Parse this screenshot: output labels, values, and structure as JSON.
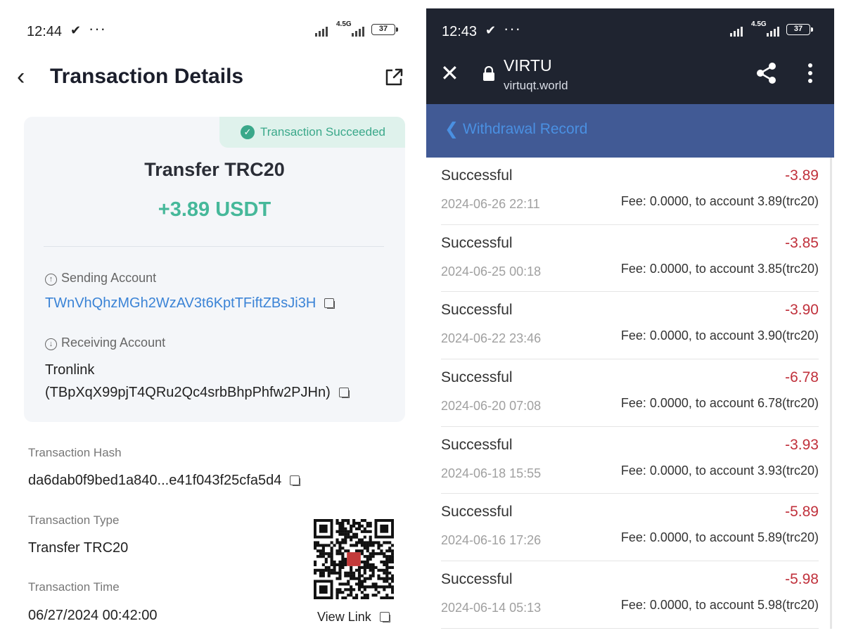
{
  "left": {
    "status": {
      "time": "12:44",
      "nav_indicator": "✔",
      "dots": "···",
      "network": "4.5G",
      "battery": "37"
    },
    "header": {
      "title": "Transaction Details"
    },
    "card": {
      "badge": "Transaction Succeeded",
      "type": "Transfer TRC20",
      "amount": "+3.89 USDT",
      "sending_label": "Sending Account",
      "sending_address": "TWnVhQhzMGh2WzAV3t6KptTFiftZBsJi3H",
      "receiving_label": "Receiving Account",
      "receiving_name": "Tronlink",
      "receiving_address": "(TBpXqX99pjT4QRu2Qc4srbBhpPhfw2PJHn)"
    },
    "fields": {
      "hash_label": "Transaction Hash",
      "hash_value": "da6dab0f9bed1a840...e41f043f25cfa5d4",
      "type_label": "Transaction Type",
      "type_value": "Transfer TRC20",
      "time_label": "Transaction Time",
      "time_value": "06/27/2024 00:42:00"
    },
    "view_link": "View Link",
    "colors": {
      "accent_green": "#46b89a",
      "link_blue": "#3a83d6"
    }
  },
  "right": {
    "status": {
      "time": "12:43",
      "nav_indicator": "✔",
      "dots": "···",
      "network": "4.5G",
      "battery": "37"
    },
    "browser": {
      "site_name": "VIRTU",
      "site_url": "virtuqt.world"
    },
    "page_title": "Withdrawal Record",
    "records": [
      {
        "status": "Successful",
        "amount": "-3.89",
        "date": "2024-06-26 22:11",
        "fee": "Fee: 0.0000, to account 3.89(trc20)"
      },
      {
        "status": "Successful",
        "amount": "-3.85",
        "date": "2024-06-25 00:18",
        "fee": "Fee: 0.0000, to account 3.85(trc20)"
      },
      {
        "status": "Successful",
        "amount": "-3.90",
        "date": "2024-06-22 23:46",
        "fee": "Fee: 0.0000, to account 3.90(trc20)"
      },
      {
        "status": "Successful",
        "amount": "-6.78",
        "date": "2024-06-20 07:08",
        "fee": "Fee: 0.0000, to account 6.78(trc20)"
      },
      {
        "status": "Successful",
        "amount": "-3.93",
        "date": "2024-06-18 15:55",
        "fee": "Fee: 0.0000, to account 3.93(trc20)"
      },
      {
        "status": "Successful",
        "amount": "-5.89",
        "date": "2024-06-16 17:26",
        "fee": "Fee: 0.0000, to account 5.89(trc20)"
      },
      {
        "status": "Successful",
        "amount": "-5.98",
        "date": "2024-06-14 05:13",
        "fee": "Fee: 0.0000, to account 5.98(trc20)"
      }
    ],
    "colors": {
      "header_dark": "#1f2430",
      "title_bar": "#415a95",
      "negative_red": "#c0303b"
    }
  }
}
